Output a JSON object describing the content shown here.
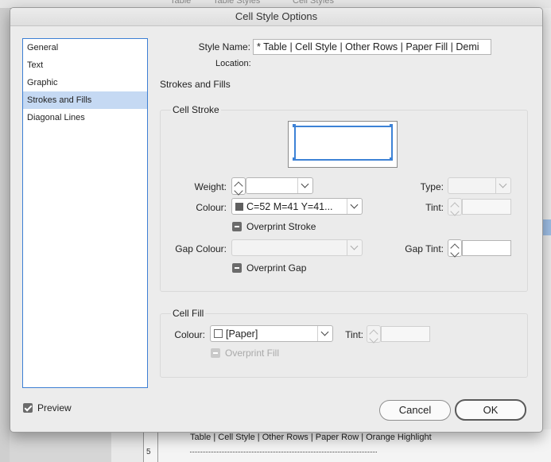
{
  "background": {
    "tabs": [
      "Table",
      "Table Styles",
      "Cell Styles"
    ],
    "row_text": "Table | Cell Style | Other Rows | Paper Row | Orange Highlight",
    "row_number": "5"
  },
  "dialog": {
    "title": "Cell Style Options",
    "nav": {
      "items": [
        "General",
        "Text",
        "Graphic",
        "Strokes and Fills",
        "Diagonal Lines"
      ],
      "selected": "Strokes and Fills"
    },
    "style_name_label": "Style Name:",
    "style_name_value": "* Table | Cell Style | Other Rows | Paper Fill | Demi",
    "location_label": "Location:",
    "section_title": "Strokes and Fills",
    "cell_stroke": {
      "title": "Cell Stroke",
      "weight_label": "Weight:",
      "weight_value": "",
      "type_label": "Type:",
      "type_value": "",
      "colour_label": "Colour:",
      "colour_value": "C=52 M=41 Y=41...",
      "colour_swatch": "#5f5f5f",
      "tint_label": "Tint:",
      "overprint_stroke_label": "Overprint Stroke",
      "gap_colour_label": "Gap Colour:",
      "gap_colour_value": "",
      "gap_tint_label": "Gap Tint:",
      "gap_tint_value": "",
      "overprint_gap_label": "Overprint Gap"
    },
    "cell_fill": {
      "title": "Cell Fill",
      "colour_label": "Colour:",
      "colour_value": "[Paper]",
      "colour_swatch": "#ffffff",
      "tint_label": "Tint:",
      "overprint_fill_label": "Overprint Fill"
    },
    "preview_label": "Preview",
    "preview_checked": true,
    "cancel_label": "Cancel",
    "ok_label": "OK"
  },
  "colors": {
    "selection": "#c5d9f3",
    "focus_blue": "#3d82d6"
  }
}
